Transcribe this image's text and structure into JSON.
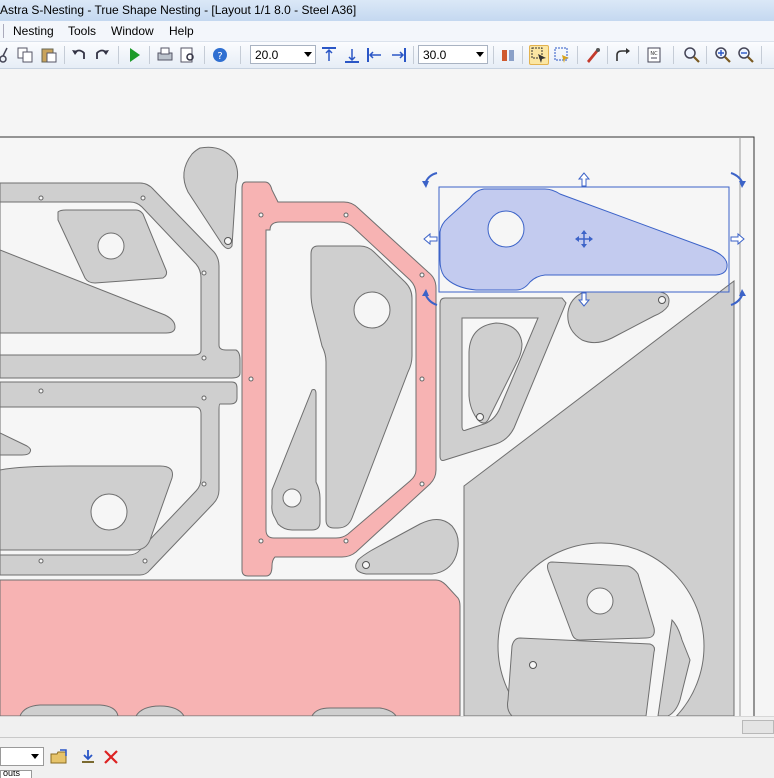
{
  "window": {
    "title": "Astra S-Nesting - True Shape Nesting - [Layout 1/1 8.0 - Steel A36]"
  },
  "menu": {
    "items": [
      "Nesting",
      "Tools",
      "Window",
      "Help"
    ]
  },
  "toolbar": {
    "distance_value": "20.0",
    "angle_value": "30.0",
    "icons": [
      "cut-icon",
      "copy-icon",
      "paste-icon",
      "undo-icon",
      "redo-icon",
      "run-icon",
      "print-icon",
      "print-preview-icon",
      "help-icon",
      "align-top-icon",
      "align-bottom-icon",
      "align-left-icon",
      "align-right-icon",
      "mirror-icon",
      "select-part-icon",
      "select-multiple-icon",
      "pen-icon",
      "rotate-icon",
      "nc-export-icon",
      "zoom-icon",
      "zoom-in-icon",
      "zoom-out-icon"
    ]
  },
  "bottom": {
    "tab_label": "outs",
    "icons": [
      "open-folder-icon",
      "download-icon",
      "delete-icon"
    ]
  },
  "colors": {
    "part_fill": "#cfcfcf",
    "part_stroke": "#6f6f6f",
    "highlight_fill": "#f7b3b3",
    "selected_fill": "#c3cbef",
    "selected_stroke": "#3c63c8",
    "sheet_bg": "#f6f6f6"
  }
}
